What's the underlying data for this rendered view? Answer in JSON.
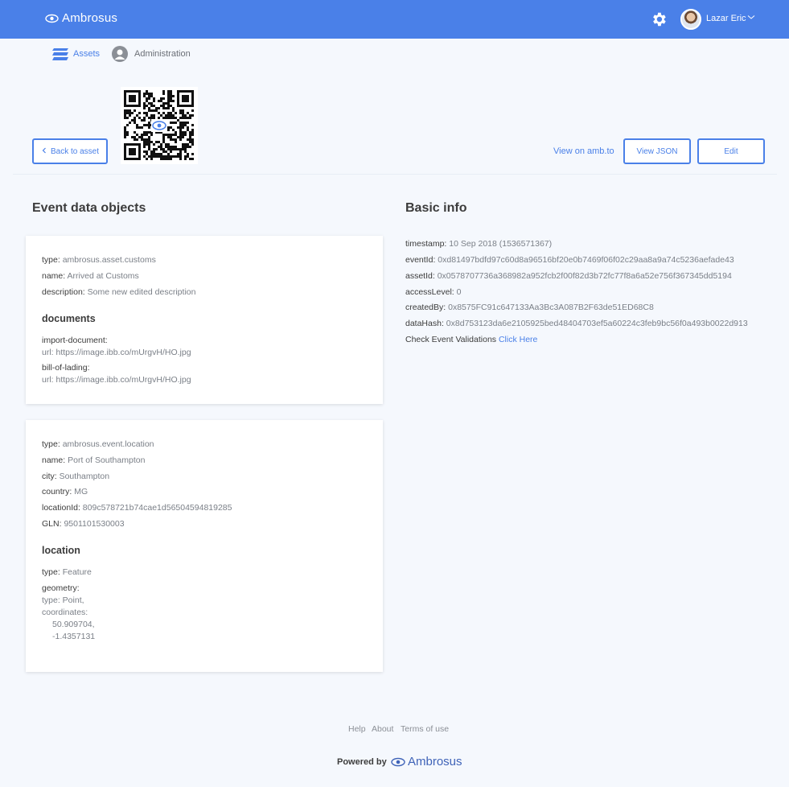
{
  "header": {
    "brand": "Ambrosus",
    "user_name": "Lazar Eric"
  },
  "nav": {
    "assets": "Assets",
    "administration": "Administration"
  },
  "actions": {
    "back": "Back to asset",
    "view_on_amb": "View on amb.to",
    "view_json": "View JSON",
    "edit": "Edit"
  },
  "event_data": {
    "title": "Event data objects",
    "obj1": {
      "type_k": "type:",
      "type_v": "ambrosus.asset.customs",
      "name_k": "name:",
      "name_v": "Arrived at Customs",
      "desc_k": "description:",
      "desc_v": "Some new edited description",
      "docs_title": "documents",
      "doc1_name": "import-document:",
      "doc1_url": "url: https://image.ibb.co/mUrgvH/HO.jpg",
      "doc2_name": "bill-of-lading:",
      "doc2_url": "url: https://image.ibb.co/mUrgvH/HO.jpg"
    },
    "obj2": {
      "type_k": "type:",
      "type_v": "ambrosus.event.location",
      "name_k": "name:",
      "name_v": "Port of Southampton",
      "city_k": "city:",
      "city_v": "Southampton",
      "country_k": "country:",
      "country_v": "MG",
      "locid_k": "locationId:",
      "locid_v": "809c578721b74cae1d56504594819285",
      "gln_k": "GLN:",
      "gln_v": "9501101530003",
      "loc_title": "location",
      "ltype_k": "type:",
      "ltype_v": "Feature",
      "geometry_k": "geometry:",
      "geo_type": "type: Point,",
      "coords_k": "coordinates:",
      "coord1": "50.909704,",
      "coord2": "-1.4357131"
    }
  },
  "basic_info": {
    "title": "Basic info",
    "timestamp_k": "timestamp:",
    "timestamp_v": "10 Sep 2018 (1536571367)",
    "eventid_k": "eventId:",
    "eventid_v": "0xd81497bdfd97c60d8a96516bf20e0b7469f06f02c29aa8a9a74c5236aefade43",
    "assetid_k": "assetId:",
    "assetid_v": "0x0578707736a368982a952fcb2f00f82d3b72fc77f8a6a52e756f367345dd5194",
    "access_k": "accessLevel:",
    "access_v": "0",
    "created_k": "createdBy:",
    "created_v": "0x8575FC91c647133Aa3Bc3A087B2F63de51ED68C8",
    "datahash_k": "dataHash:",
    "datahash_v": "0x8d753123da6e2105925bed48404703ef5a60224c3feb9bc56f0a493b0022d913",
    "check_label": "Check Event Validations",
    "check_link": "Click Here"
  },
  "footer": {
    "help": "Help",
    "about": "About",
    "terms": "Terms of use",
    "powered_by": "Powered by",
    "brand": "Ambrosus"
  },
  "colors": {
    "primary": "#4a80e8",
    "header_bg": "#4a80e8",
    "page_bg": "#f5f8fd"
  }
}
